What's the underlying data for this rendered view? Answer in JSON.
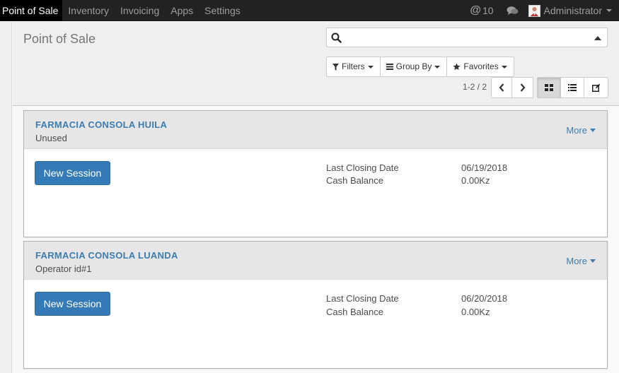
{
  "navbar": {
    "menu": [
      "Point of Sale",
      "Inventory",
      "Invoicing",
      "Apps",
      "Settings"
    ],
    "messages_count": "10",
    "user_name": "Administrator"
  },
  "control_panel": {
    "breadcrumb": "Point of Sale",
    "search_placeholder": "",
    "filters_label": "Filters",
    "group_by_label": "Group By",
    "favorites_label": "Favorites",
    "pager_value": "1-2 / 2"
  },
  "cards": [
    {
      "title": "FARMACIA CONSOLA HUILA",
      "subtitle": "Unused",
      "more_label": "More",
      "button_label": "New Session",
      "last_closing_label": "Last Closing Date",
      "last_closing_value": "06/19/2018",
      "cash_balance_label": "Cash Balance",
      "cash_balance_value": "0.00Kz"
    },
    {
      "title": "FARMACIA CONSOLA LUANDA",
      "subtitle": "Operator id#1",
      "more_label": "More",
      "button_label": "New Session",
      "last_closing_label": "Last Closing Date",
      "last_closing_value": "06/20/2018",
      "cash_balance_label": "Cash Balance",
      "cash_balance_value": "0.00Kz"
    }
  ],
  "colors": {
    "navbar_bg": "#222222",
    "link_blue": "#3d7cb0",
    "primary_button": "#337ab7"
  },
  "icons": {
    "messages": "at-sign-icon",
    "chat": "chat-bubbles-icon",
    "search": "search-icon",
    "filters": "filter-icon",
    "group_by": "bars-icon",
    "favorites": "star-icon",
    "pager_prev": "chevron-left-icon",
    "pager_next": "chevron-right-icon",
    "view_kanban": "kanban-view-icon",
    "view_list": "list-view-icon",
    "view_form": "edit-form-icon"
  }
}
